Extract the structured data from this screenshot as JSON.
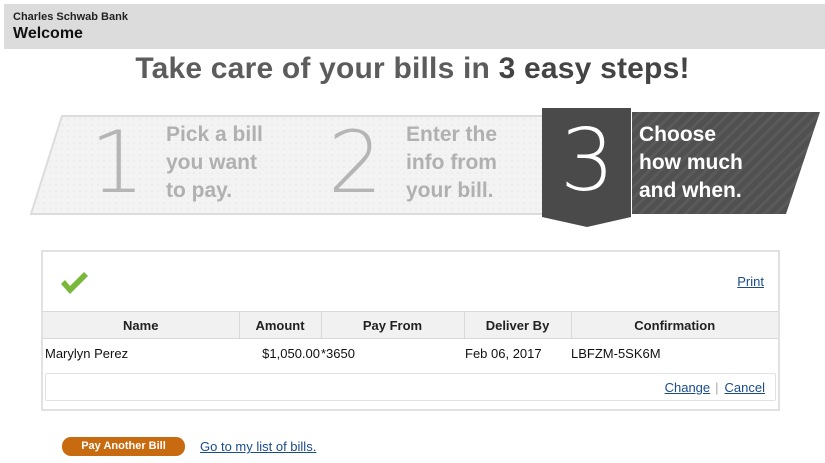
{
  "header": {
    "bank_name": "Charles Schwab Bank",
    "welcome": "Welcome"
  },
  "headline": {
    "prefix": "Take care of your bills in ",
    "emphasis": "3 easy steps!"
  },
  "steps": [
    {
      "number": "1",
      "line1": "Pick a bill",
      "line2": "you want",
      "line3": "to pay."
    },
    {
      "number": "2",
      "line1": "Enter the",
      "line2": "info from",
      "line3": "your bill."
    },
    {
      "number": "3",
      "line1": "Choose",
      "line2": "how much",
      "line3": "and when."
    }
  ],
  "panel": {
    "status_icon": "checkmark-icon",
    "print_label": "Print",
    "columns": [
      "Name",
      "Amount",
      "Pay From",
      "Deliver By",
      "Confirmation"
    ],
    "rows": [
      {
        "name": "Marylyn Perez",
        "amount": "$1,050.00",
        "pay_from": "*3650",
        "deliver_by": "Feb 06, 2017",
        "confirmation": "LBFZM-5SK6M"
      }
    ],
    "change_label": "Change",
    "cancel_label": "Cancel"
  },
  "footer": {
    "pay_another_label": "Pay Another Bill",
    "go_to_list_label": "Go to my list of bills."
  },
  "colors": {
    "accent_orange": "#c86a0f",
    "link_blue": "#1a4c8a",
    "check_green": "#7ab83a",
    "active_step_bg": "#4f4f4f"
  }
}
